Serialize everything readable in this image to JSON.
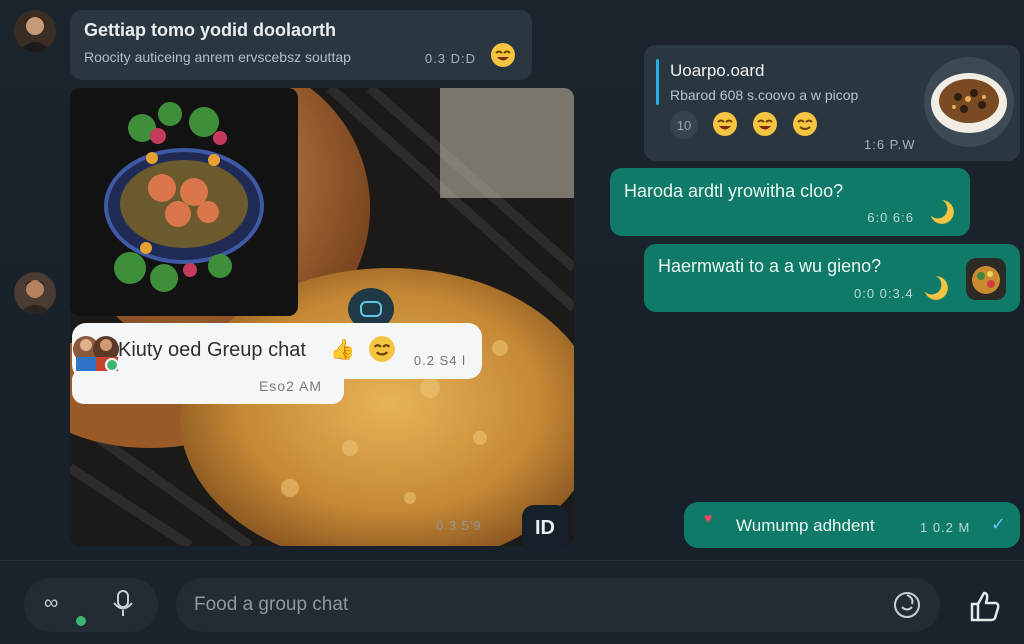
{
  "messages": {
    "first": {
      "title": "Gettiap tomo yodid doolaorth",
      "subtitle": "Roocity auticeing anrem ervscebsz souttap",
      "time": "0.3 D:D",
      "emoji": "😆"
    },
    "image_thumb_time": "Eso2 AM",
    "group_chip": {
      "label": "Kiuty oed Greup chat",
      "fire": "👍",
      "emoji": "😆",
      "time": "0.2 S4 l"
    },
    "media_time": "0.3 5'9",
    "media_badge": "ID",
    "reply_card": {
      "title": "Uoarpo.oard",
      "subtitle": "Rbarod 608 s.coovo a w picop",
      "ring_label": "10",
      "emojis": [
        "😆",
        "😆",
        "😆"
      ],
      "time": "1:6 P.W"
    },
    "out1": {
      "text": "Haroda ardtl yrowitha cloo?",
      "time": "6:0 6:6",
      "emoji": "🌙"
    },
    "out2": {
      "text": "Haermwati to a a wu gieno?",
      "time": "0:0 0:3.4",
      "emoji": "🌙"
    },
    "out3": {
      "text": "Wumump adhdent",
      "time": "1 0.2 M",
      "heart": "♥",
      "check": "✓"
    }
  },
  "composer": {
    "placeholder": "Food a group chat",
    "attach_icon": "paperclip-icon",
    "mic_icon": "microphone-icon",
    "emoji_icon": "smiley-icon",
    "like_icon": "thumbs-up-icon"
  },
  "colors": {
    "background": "#182129",
    "incoming_bubble": "#2a3640",
    "outgoing_bubble": "#0f7a67",
    "accent": "#27b1ea"
  }
}
